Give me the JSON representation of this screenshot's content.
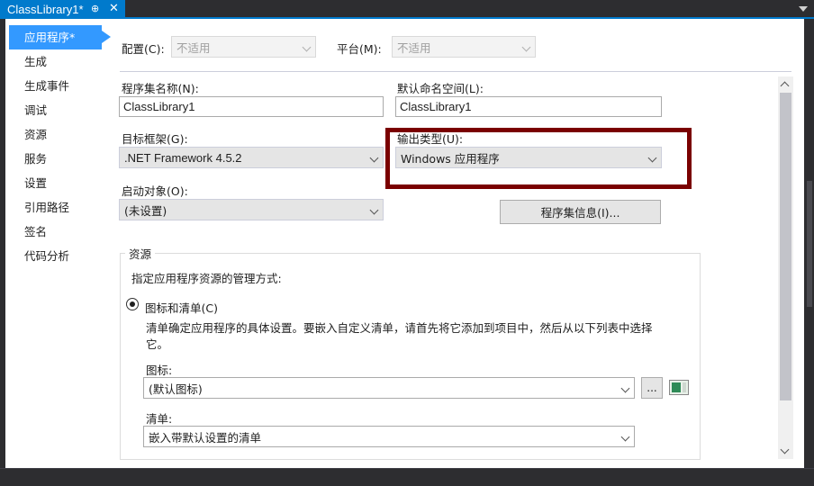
{
  "tab": {
    "title": "ClassLibrary1*",
    "pin": "⊕",
    "close": "✕"
  },
  "nav": {
    "items": [
      {
        "label": "应用程序*"
      },
      {
        "label": "生成"
      },
      {
        "label": "生成事件"
      },
      {
        "label": "调试"
      },
      {
        "label": "资源"
      },
      {
        "label": "服务"
      },
      {
        "label": "设置"
      },
      {
        "label": "引用路径"
      },
      {
        "label": "签名"
      },
      {
        "label": "代码分析"
      }
    ]
  },
  "config": {
    "label": "配置(C):",
    "value": "不适用"
  },
  "platform": {
    "label": "平台(M):",
    "value": "不适用"
  },
  "assembly_name": {
    "label": "程序集名称(N):",
    "value": "ClassLibrary1"
  },
  "default_namespace": {
    "label": "默认命名空间(L):",
    "value": "ClassLibrary1"
  },
  "target_framework": {
    "label": "目标框架(G):",
    "value": ".NET Framework 4.5.2"
  },
  "output_type": {
    "label": "输出类型(U):",
    "value": "Windows 应用程序"
  },
  "startup_object": {
    "label": "启动对象(O):",
    "value": "(未设置)"
  },
  "assembly_info_button": "程序集信息(I)...",
  "resources": {
    "group_title": "资源",
    "instruction": "指定应用程序资源的管理方式:",
    "radio_label": "图标和清单(C)",
    "description_line1": "清单确定应用程序的具体设置。要嵌入自定义清单，请首先将它添加到项目中，然后从以下列表中选择",
    "description_line2": "它。",
    "icon_label": "图标:",
    "icon_value": "(默认图标)",
    "browse_label": "...",
    "manifest_label": "清单:",
    "manifest_value": "嵌入带默认设置的清单"
  },
  "colors": {
    "accent": "#007acc",
    "nav_active": "#3399ff",
    "highlight": "#7a0000"
  }
}
